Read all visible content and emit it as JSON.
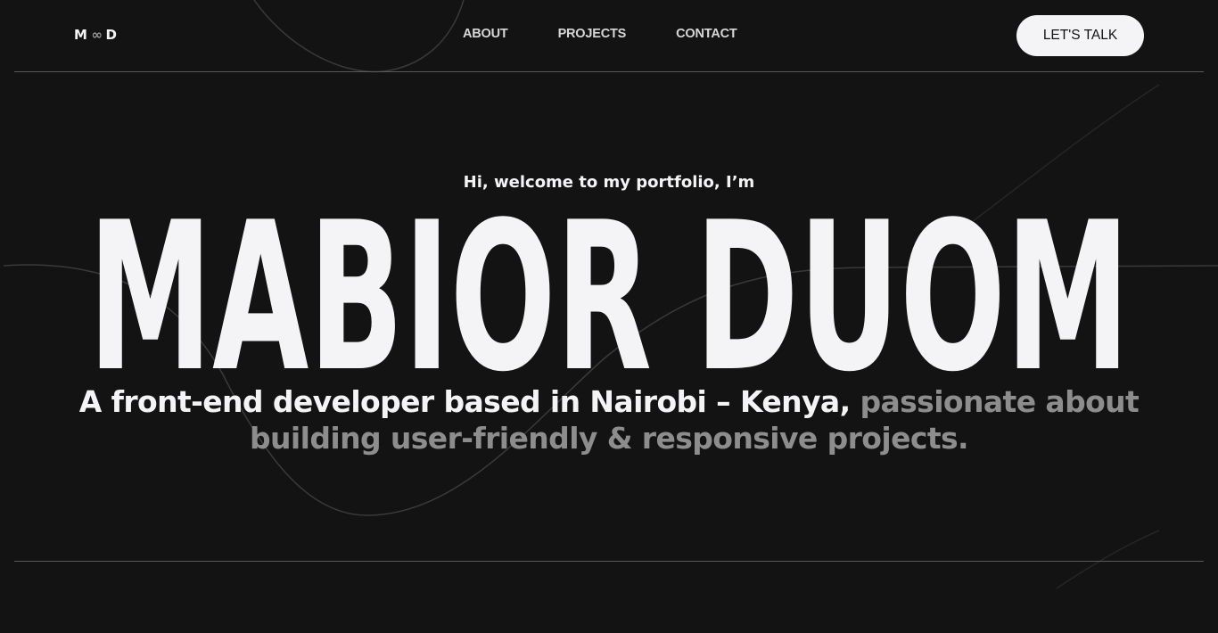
{
  "header": {
    "logo": {
      "left": "M",
      "middle": "∞",
      "right": "D"
    },
    "nav": [
      {
        "label": "ABOUT"
      },
      {
        "label": "PROJECTS"
      },
      {
        "label": "CONTACT"
      }
    ],
    "cta_label": "LET'S TALK"
  },
  "hero": {
    "greeting": "Hi, welcome to my portfolio, I’m",
    "name": "MABIOR DUOM",
    "tagline_strong": "A front-end developer based in Nairobi – Kenya,",
    "tagline_muted": "passionate about building user-friendly & responsive projects."
  },
  "colors": {
    "background": "#131313",
    "foreground": "#f4f4f6",
    "muted": "#8d8d8d",
    "rule": "#5a5a5a"
  }
}
